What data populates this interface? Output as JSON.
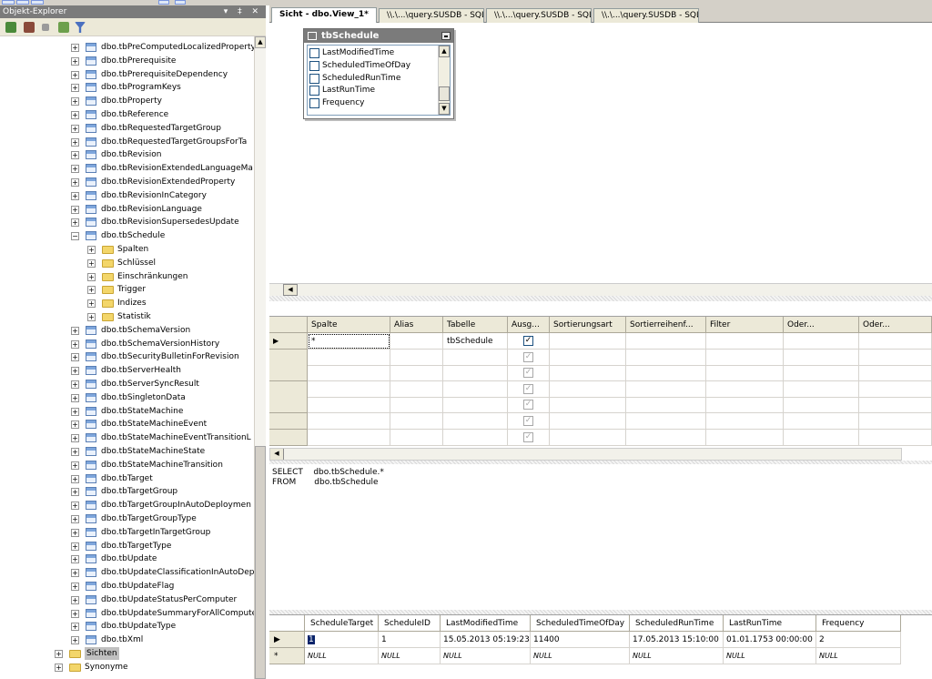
{
  "object_explorer": {
    "title": "Objekt-Explorer",
    "title_controls": "▾ ‡ ✕",
    "toolbar_icons": [
      "connect-icon",
      "disconnect-icon",
      "stop-icon",
      "refresh-icon",
      "filter-icon"
    ],
    "items": [
      {
        "label": "dbo.tbPreComputedLocalizedProperty",
        "kind": "table",
        "level": 0,
        "exp": "+"
      },
      {
        "label": "dbo.tbPrerequisite",
        "kind": "table",
        "level": 0,
        "exp": "+"
      },
      {
        "label": "dbo.tbPrerequisiteDependency",
        "kind": "table",
        "level": 0,
        "exp": "+"
      },
      {
        "label": "dbo.tbProgramKeys",
        "kind": "table",
        "level": 0,
        "exp": "+"
      },
      {
        "label": "dbo.tbProperty",
        "kind": "table",
        "level": 0,
        "exp": "+"
      },
      {
        "label": "dbo.tbReference",
        "kind": "table",
        "level": 0,
        "exp": "+"
      },
      {
        "label": "dbo.tbRequestedTargetGroup",
        "kind": "table",
        "level": 0,
        "exp": "+"
      },
      {
        "label": "dbo.tbRequestedTargetGroupsForTa",
        "kind": "table",
        "level": 0,
        "exp": "+"
      },
      {
        "label": "dbo.tbRevision",
        "kind": "table",
        "level": 0,
        "exp": "+"
      },
      {
        "label": "dbo.tbRevisionExtendedLanguageMa",
        "kind": "table",
        "level": 0,
        "exp": "+"
      },
      {
        "label": "dbo.tbRevisionExtendedProperty",
        "kind": "table",
        "level": 0,
        "exp": "+"
      },
      {
        "label": "dbo.tbRevisionInCategory",
        "kind": "table",
        "level": 0,
        "exp": "+"
      },
      {
        "label": "dbo.tbRevisionLanguage",
        "kind": "table",
        "level": 0,
        "exp": "+"
      },
      {
        "label": "dbo.tbRevisionSupersedesUpdate",
        "kind": "table",
        "level": 0,
        "exp": "+"
      },
      {
        "label": "dbo.tbSchedule",
        "kind": "table",
        "level": 0,
        "exp": "−"
      },
      {
        "label": "Spalten",
        "kind": "folder",
        "level": 1,
        "exp": "+"
      },
      {
        "label": "Schlüssel",
        "kind": "folder",
        "level": 1,
        "exp": "+"
      },
      {
        "label": "Einschränkungen",
        "kind": "folder",
        "level": 1,
        "exp": "+"
      },
      {
        "label": "Trigger",
        "kind": "folder",
        "level": 1,
        "exp": "+"
      },
      {
        "label": "Indizes",
        "kind": "folder",
        "level": 1,
        "exp": "+"
      },
      {
        "label": "Statistik",
        "kind": "folder",
        "level": 1,
        "exp": "+"
      },
      {
        "label": "dbo.tbSchemaVersion",
        "kind": "table",
        "level": 0,
        "exp": "+"
      },
      {
        "label": "dbo.tbSchemaVersionHistory",
        "kind": "table",
        "level": 0,
        "exp": "+"
      },
      {
        "label": "dbo.tbSecurityBulletinForRevision",
        "kind": "table",
        "level": 0,
        "exp": "+"
      },
      {
        "label": "dbo.tbServerHealth",
        "kind": "table",
        "level": 0,
        "exp": "+"
      },
      {
        "label": "dbo.tbServerSyncResult",
        "kind": "table",
        "level": 0,
        "exp": "+"
      },
      {
        "label": "dbo.tbSingletonData",
        "kind": "table",
        "level": 0,
        "exp": "+"
      },
      {
        "label": "dbo.tbStateMachine",
        "kind": "table",
        "level": 0,
        "exp": "+"
      },
      {
        "label": "dbo.tbStateMachineEvent",
        "kind": "table",
        "level": 0,
        "exp": "+"
      },
      {
        "label": "dbo.tbStateMachineEventTransitionL",
        "kind": "table",
        "level": 0,
        "exp": "+"
      },
      {
        "label": "dbo.tbStateMachineState",
        "kind": "table",
        "level": 0,
        "exp": "+"
      },
      {
        "label": "dbo.tbStateMachineTransition",
        "kind": "table",
        "level": 0,
        "exp": "+"
      },
      {
        "label": "dbo.tbTarget",
        "kind": "table",
        "level": 0,
        "exp": "+"
      },
      {
        "label": "dbo.tbTargetGroup",
        "kind": "table",
        "level": 0,
        "exp": "+"
      },
      {
        "label": "dbo.tbTargetGroupInAutoDeploymen",
        "kind": "table",
        "level": 0,
        "exp": "+"
      },
      {
        "label": "dbo.tbTargetGroupType",
        "kind": "table",
        "level": 0,
        "exp": "+"
      },
      {
        "label": "dbo.tbTargetInTargetGroup",
        "kind": "table",
        "level": 0,
        "exp": "+"
      },
      {
        "label": "dbo.tbTargetType",
        "kind": "table",
        "level": 0,
        "exp": "+"
      },
      {
        "label": "dbo.tbUpdate",
        "kind": "table",
        "level": 0,
        "exp": "+"
      },
      {
        "label": "dbo.tbUpdateClassificationInAutoDep",
        "kind": "table",
        "level": 0,
        "exp": "+"
      },
      {
        "label": "dbo.tbUpdateFlag",
        "kind": "table",
        "level": 0,
        "exp": "+"
      },
      {
        "label": "dbo.tbUpdateStatusPerComputer",
        "kind": "table",
        "level": 0,
        "exp": "+"
      },
      {
        "label": "dbo.tbUpdateSummaryForAllCompute",
        "kind": "table",
        "level": 0,
        "exp": "+"
      },
      {
        "label": "dbo.tbUpdateType",
        "kind": "table",
        "level": 0,
        "exp": "+"
      },
      {
        "label": "dbo.tbXml",
        "kind": "table",
        "level": 0,
        "exp": "+"
      },
      {
        "label": "Sichten",
        "kind": "folder",
        "level": -1,
        "exp": "+",
        "selected": true
      },
      {
        "label": "Synonyme",
        "kind": "folder",
        "level": -1,
        "exp": "+"
      }
    ]
  },
  "tabs": [
    {
      "label": "Sicht - dbo.View_1*",
      "active": true
    },
    {
      "label": "\\\\.\\...\\query.SUSDB - SQLQue...l",
      "active": false
    },
    {
      "label": "\\\\.\\...\\query.SUSDB - SQLQue...l",
      "active": false
    },
    {
      "label": "\\\\.\\...\\query.SUSDB - SQLQue...l",
      "active": false
    }
  ],
  "diagram": {
    "table_name": "tbSchedule",
    "columns": [
      "LastModifiedTime",
      "ScheduledTimeOfDay",
      "ScheduledRunTime",
      "LastRunTime",
      "Frequency"
    ]
  },
  "criteria": {
    "headers": [
      "Spalte",
      "Alias",
      "Tabelle",
      "Ausg...",
      "Sortierungsart",
      "Sortierreihenf...",
      "Filter",
      "Oder...",
      "Oder..."
    ],
    "rows": [
      {
        "spalte": "*",
        "alias": "",
        "tabelle": "tbSchedule",
        "ausgabe": true,
        "current": true
      },
      {
        "spalte": "",
        "alias": "",
        "tabelle": "",
        "ausgabe": true,
        "current": false
      },
      {
        "spalte": "",
        "alias": "",
        "tabelle": "",
        "ausgabe": true,
        "current": false
      },
      {
        "spalte": "",
        "alias": "",
        "tabelle": "",
        "ausgabe": true,
        "current": false
      },
      {
        "spalte": "",
        "alias": "",
        "tabelle": "",
        "ausgabe": true,
        "current": false
      },
      {
        "spalte": "",
        "alias": "",
        "tabelle": "",
        "ausgabe": true,
        "current": false
      },
      {
        "spalte": "",
        "alias": "",
        "tabelle": "",
        "ausgabe": true,
        "current": false
      }
    ],
    "current_row_marker": "▶",
    "check_glyph": "✓"
  },
  "sql": {
    "lines": [
      "SELECT    dbo.tbSchedule.*",
      "FROM       dbo.tbSchedule"
    ]
  },
  "results": {
    "headers": [
      "ScheduleTarget",
      "ScheduleID",
      "LastModifiedTime",
      "ScheduledTimeOfDay",
      "ScheduledRunTime",
      "LastRunTime",
      "Frequency"
    ],
    "rows": [
      {
        "marker": "▶",
        "cells": [
          "1",
          "1",
          "15.05.2013 05:19:23",
          "11400",
          "17.05.2013 15:10:00",
          "01.01.1753 00:00:00",
          "2"
        ]
      },
      {
        "marker": "*",
        "cells": [
          "NULL",
          "NULL",
          "NULL",
          "NULL",
          "NULL",
          "NULL",
          "NULL"
        ],
        "is_null": true
      }
    ]
  }
}
